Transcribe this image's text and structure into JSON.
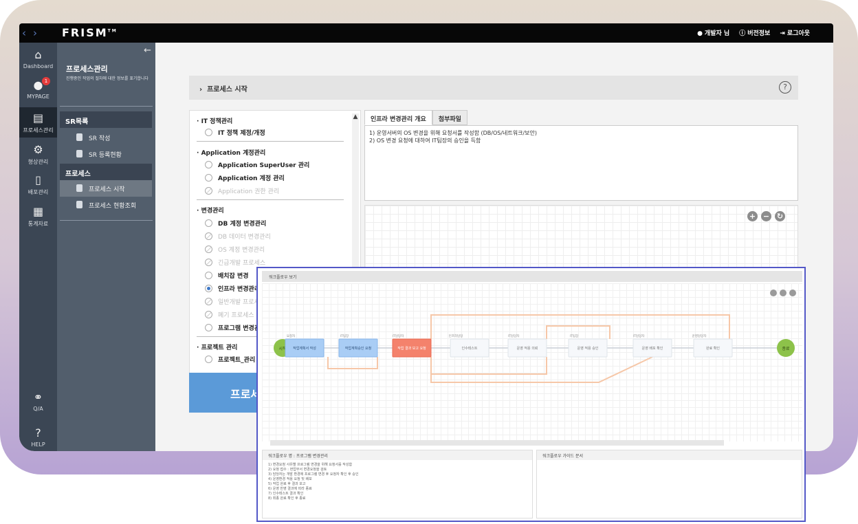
{
  "topbar": {
    "logo": "FRISM",
    "logo_tm": "TM",
    "user_label": "개발자 님",
    "version_label": "버전정보",
    "logout_label": "로그아웃"
  },
  "iconbar": [
    {
      "label": "Dashboard",
      "icon": "home-icon"
    },
    {
      "label": "MYPAGE",
      "icon": "user-icon",
      "badge": "1"
    },
    {
      "label": "프로세스관리",
      "icon": "archive-icon"
    },
    {
      "label": "형상관리",
      "icon": "gears-icon"
    },
    {
      "label": "배포관리",
      "icon": "mobile-icon"
    },
    {
      "label": "통계자료",
      "icon": "stats-icon"
    },
    {
      "label": "Q/A",
      "icon": "qa-icon"
    },
    {
      "label": "HELP",
      "icon": "help-icon"
    }
  ],
  "sidebar": {
    "title": "프로세스관리",
    "desc": "진행중인 작업의 절차에 대한 정보를 표기합니다",
    "sections": [
      {
        "label": "SR목록",
        "items": [
          "SR 작성",
          "SR 등록현황"
        ]
      },
      {
        "label": "프로세스",
        "items": [
          "프로세스 시작",
          "프로세스 현황조회"
        ]
      }
    ]
  },
  "process_bar": {
    "title": "프로세스 시작"
  },
  "process_list": {
    "groups": [
      {
        "title": "IT 정책관리",
        "options": [
          {
            "label": "IT 정책 제정/개정",
            "state": "bold"
          }
        ]
      },
      {
        "title": "Application 계정관리",
        "options": [
          {
            "label": "Application SuperUser 관리",
            "state": "bold"
          },
          {
            "label": "Application 계정 관리",
            "state": "bold"
          },
          {
            "label": "Application 권한 관리",
            "state": "disabled"
          }
        ]
      },
      {
        "title": "변경관리",
        "options": [
          {
            "label": "DB 계정 변경관리",
            "state": "bold"
          },
          {
            "label": "DB 데이터 변경관리",
            "state": "disabled"
          },
          {
            "label": "OS 계정 변경관리",
            "state": "disabled"
          },
          {
            "label": "긴급개발 프로세스",
            "state": "disabled"
          },
          {
            "label": "배치잡 변경",
            "state": "bold"
          },
          {
            "label": "인프라 변경관리",
            "state": "selected"
          },
          {
            "label": "일반개발 프로세스",
            "state": "disabled"
          },
          {
            "label": "폐기 프로세스",
            "state": "disabled"
          },
          {
            "label": "프로그램 변경관리",
            "state": "bold"
          }
        ]
      },
      {
        "title": "프로젝트 관리",
        "options": [
          {
            "label": "프로젝트_관리",
            "state": "bold"
          }
        ]
      }
    ],
    "start_button": "프로세스 시작"
  },
  "tabs": [
    "인프라 변경관리 개요",
    "첨부파일"
  ],
  "description": [
    "1) 운영서버의 OS 변경을 위해 요청서를 작성함 (DB/OS/네트워크/보안)",
    "2) OS 변경 요청에 대하여 IT팀장의 승인을 득함"
  ],
  "overlay": {
    "title": "워크플로우 보기",
    "start_node": "시작",
    "end_node": "종료",
    "nodes": [
      {
        "role": "요청자",
        "label": "작업계획서 작성",
        "style": "blue"
      },
      {
        "role": "IT팀장",
        "label": "작업계획승인 요청",
        "style": "blue"
      },
      {
        "role": "IT담당자",
        "label": "작업 결과 보고 요청",
        "style": "red"
      },
      {
        "role": "인프라담당",
        "label": "인수테스트",
        "style": "plain"
      },
      {
        "role": "IT담당자",
        "label": "운영 적용 의뢰",
        "style": "plain"
      },
      {
        "role": "IT팀장",
        "label": "운영 적용 승인",
        "style": "plain"
      },
      {
        "role": "IT담당자",
        "label": "운영 배포 확인",
        "style": "plain"
      },
      {
        "role": "운영담당자",
        "label": "완료 확인",
        "style": "plain"
      }
    ],
    "bottom_left_title": "워크플로우 명 : 프로그램 변경관리",
    "bottom_left_lines": [
      "1) 변경요청 사유별 프로그램 변경을 위해 요청서를 작성함",
      "2) 요청 접수 : 현업부서 변경요청을 검토",
      "3) 담당자는 개발 환경에 프로그램 변경 후 요청자 확인 후 승인",
      "4) 운영환경 적용 요청 및 배포",
      "5) 작업 완료 후 결과 보고",
      "6) 운영 반영 결과에 따라 종료",
      "7) 인수테스트 결과 확인",
      "8) 최종 완료 확인 후 종료"
    ],
    "bottom_right_title": "워크플로우 가이드 문서"
  },
  "colors": {
    "topbar": "#070707",
    "iconbar": "#3b4654",
    "sidebar": "#525e6c",
    "accent_blue": "#5b9ad8",
    "overlay_border": "#5257c7",
    "node_red": "#f4826c",
    "node_blue": "#a9cdf5",
    "node_green": "#8dc24a"
  }
}
